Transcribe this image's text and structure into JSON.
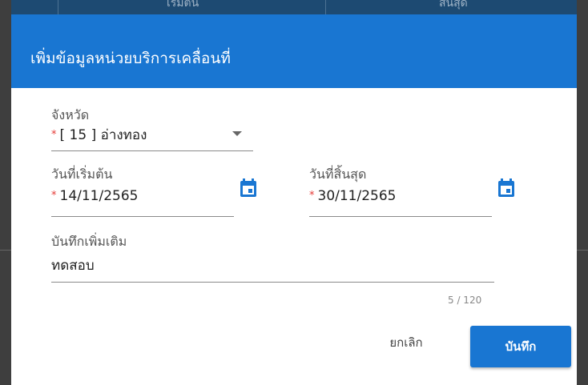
{
  "background_table": {
    "headers": [
      "เริ่มต้น",
      "สิ้นสุด"
    ]
  },
  "dialog": {
    "title": "เพิ่มข้อมูลหน่วยบริการเคลื่อนที่",
    "province": {
      "label": "จังหวัด",
      "value": "[ 15 ] อ่างทอง",
      "required_marker": "*"
    },
    "start_date": {
      "label": "วันที่เริ่มต้น",
      "value": "14/11/2565",
      "required_marker": "*",
      "icon": "calendar-icon"
    },
    "end_date": {
      "label": "วันที่สิ้นสุด",
      "value": "30/11/2565",
      "required_marker": "*",
      "icon": "calendar-icon"
    },
    "note": {
      "label": "บันทึกเพิ่มเติม",
      "value": "ทดสอบ",
      "counter": "5 / 120"
    },
    "actions": {
      "cancel_label": "ยกเลิก",
      "save_label": "บันทึก"
    }
  },
  "colors": {
    "primary": "#1976d2",
    "required": "#e53935",
    "backdrop_header": "#1d4a72"
  }
}
